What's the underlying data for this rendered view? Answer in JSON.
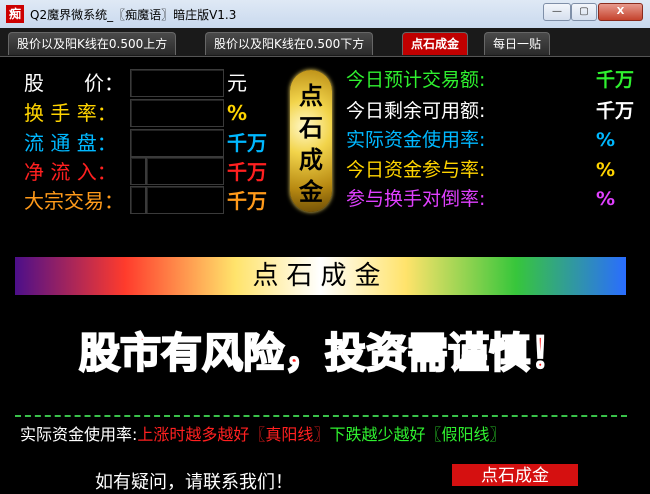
{
  "window": {
    "app_icon_text": "痴",
    "title": "Q2魔界微系统_〖痴魔语〗暗庄版V1.3",
    "minimize": "—",
    "maximize": "▢",
    "close": "X"
  },
  "tabs": [
    {
      "label": "股价以及阳K线在0.500上方"
    },
    {
      "label": "股价以及阳K线在0.500下方"
    },
    {
      "label": "点石成金"
    },
    {
      "label": "每日一贴"
    }
  ],
  "left_fields": [
    {
      "label": "股　　价：",
      "unit": "元",
      "value": "",
      "label_color": "#ffffff",
      "unit_color": "#ffffff"
    },
    {
      "label": "换 手 率：",
      "unit": "%",
      "value": "",
      "label_color": "#ffd400",
      "unit_color": "#ffd400"
    },
    {
      "label": "流 通 盘：",
      "unit": "千万",
      "value": "",
      "label_color": "#00b8ff",
      "unit_color": "#00b8ff"
    },
    {
      "label": "净 流 入：",
      "unit": "千万",
      "value": "",
      "label_color": "#ff2020",
      "unit_color": "#ff2020"
    },
    {
      "label": "大宗交易：",
      "unit": "千万",
      "value": "",
      "label_color": "#ff9a1a",
      "unit_color": "#ff9a1a"
    }
  ],
  "badge": {
    "chars": [
      "点",
      "石",
      "成",
      "金"
    ]
  },
  "right_fields": [
    {
      "label": "今日预计交易额:",
      "unit": "千万",
      "label_color": "#2ff02f",
      "unit_color": "#2ff02f"
    },
    {
      "label": "今日剩余可用额:",
      "unit": "千万",
      "label_color": "#ffffff",
      "unit_color": "#ffffff"
    },
    {
      "label": "实际资金使用率:",
      "unit": "%",
      "label_color": "#00b8ff",
      "unit_color": "#00b8ff"
    },
    {
      "label": "今日资金参与率:",
      "unit": "%",
      "label_color": "#ffd400",
      "unit_color": "#ffd400"
    },
    {
      "label": "参与换手对倒率:",
      "unit": "%",
      "label_color": "#e040ff",
      "unit_color": "#e040ff"
    }
  ],
  "banner": {
    "text": "点石成金"
  },
  "warning": {
    "text": "股市有风险，投资需谨慎！"
  },
  "tip": {
    "label": "实际资金使用率:",
    "rise": "上涨时越多越好〖",
    "rise_tag": "真阳线",
    "rise_end": "〗",
    "fall": "下跌越少越好〖",
    "fall_tag": "假阳线",
    "fall_end": "〗"
  },
  "contact": {
    "text": "如有疑问，请联系我们！",
    "button": "点石成金"
  }
}
